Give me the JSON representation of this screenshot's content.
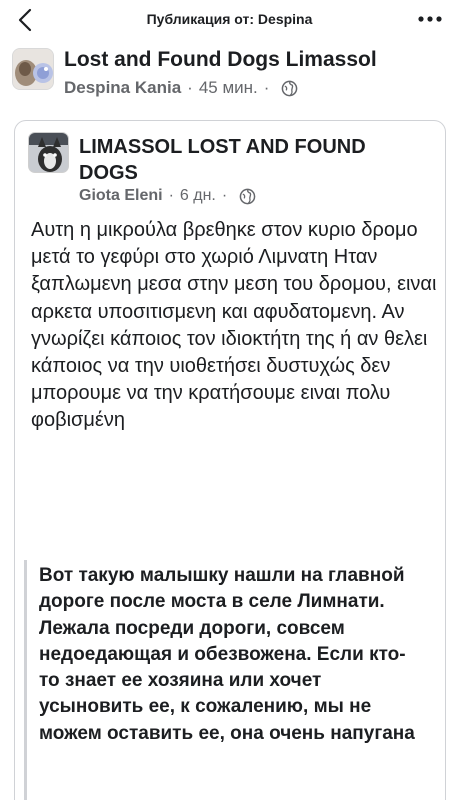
{
  "topbar": {
    "title": "Публикация от: Despina"
  },
  "group": {
    "name": "Lost and Found Dogs Limassol",
    "author": "Despina Kania",
    "time": "45 мин.",
    "separator": "·"
  },
  "shared": {
    "group_name": "LIMASSOL LOST AND FOUND DOGS",
    "author": "Giota Eleni",
    "time": "6 дн.",
    "separator": "·",
    "text": "Αυτη η μικρούλα βρεθηκε στον κυριο δρομο μετά το γεφύρι στο χωριό Λιμνατη Ηταν ξαπλωμενη μεσα στην μεση του δρομου, ειναι αρκετα υποσιτισμενη και αφυδατομενη. Αν γνωρίζει κάποιος τον ιδιοκτήτη της ή αν θελει κάποιος να την υιοθετήσει δυστυχώς δεν μπορουμε να την κρατήσουμε ειναι πολυ φοβισμένη",
    "translation": "Вот такую малышку нашли на главной дороге после моста в селе Лимнати. Лежала посреди дороги, совсем недоедающая и обезвожена. Если кто-то знает ее хозяина или хочет усыновить ее, к сожалению, мы не можем оставить ее, она очень напугана"
  },
  "icons": {
    "back": "chevron-left-icon",
    "more": "more-dots-icon",
    "privacy": "globe-icon"
  }
}
